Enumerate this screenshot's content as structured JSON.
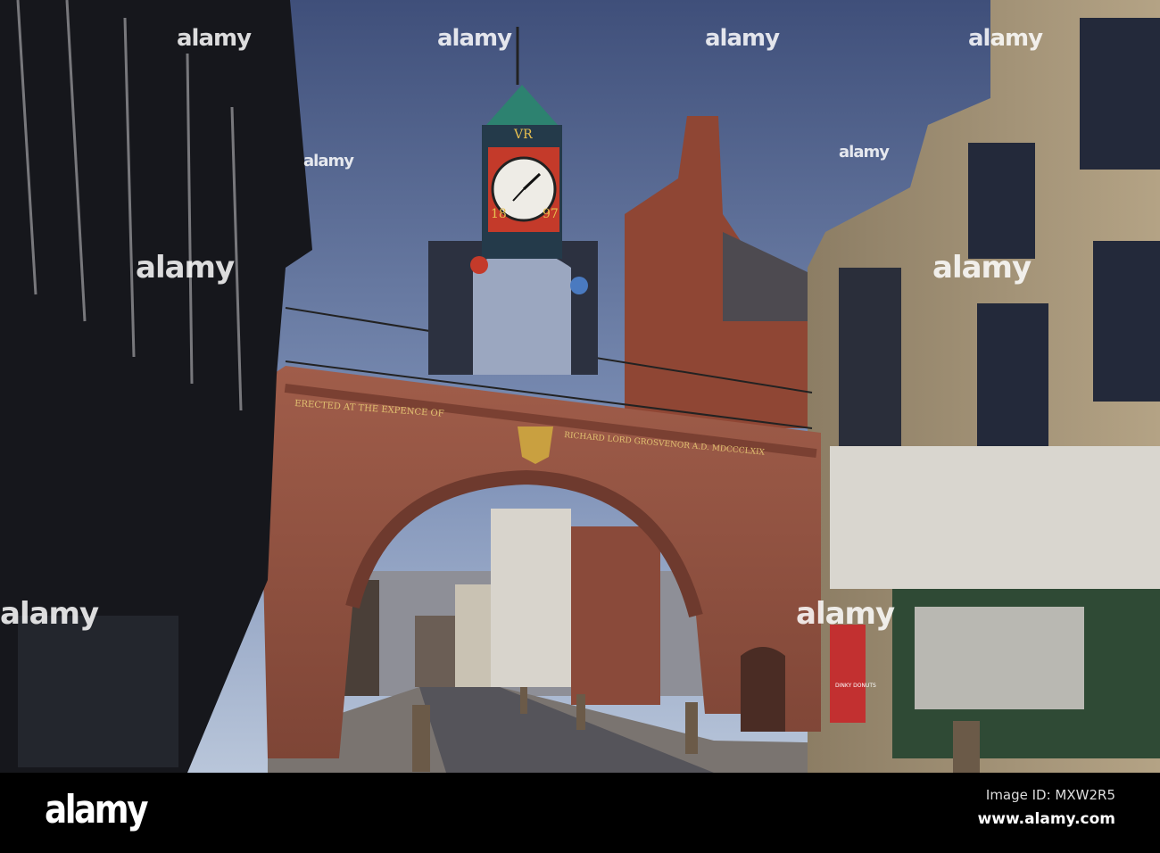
{
  "photo": {
    "inscription_left": "ERECTED AT THE EXPENCE OF",
    "inscription_right": "RICHARD LORD GROSVENOR A.D. MDCCCLXIX",
    "clock_year_left": "18",
    "clock_year_right": "97",
    "clock_monogram": "VR",
    "shop_sign": "DINKY DONUTS"
  },
  "watermark": {
    "text": "alamy"
  },
  "footer": {
    "logo": "alamy",
    "image_id": "Image ID: MXW2R5",
    "url": "www.alamy.com"
  },
  "colors": {
    "sky": "#5b6d96",
    "sandstone": "#9a5444",
    "stone": "#a8977a"
  }
}
